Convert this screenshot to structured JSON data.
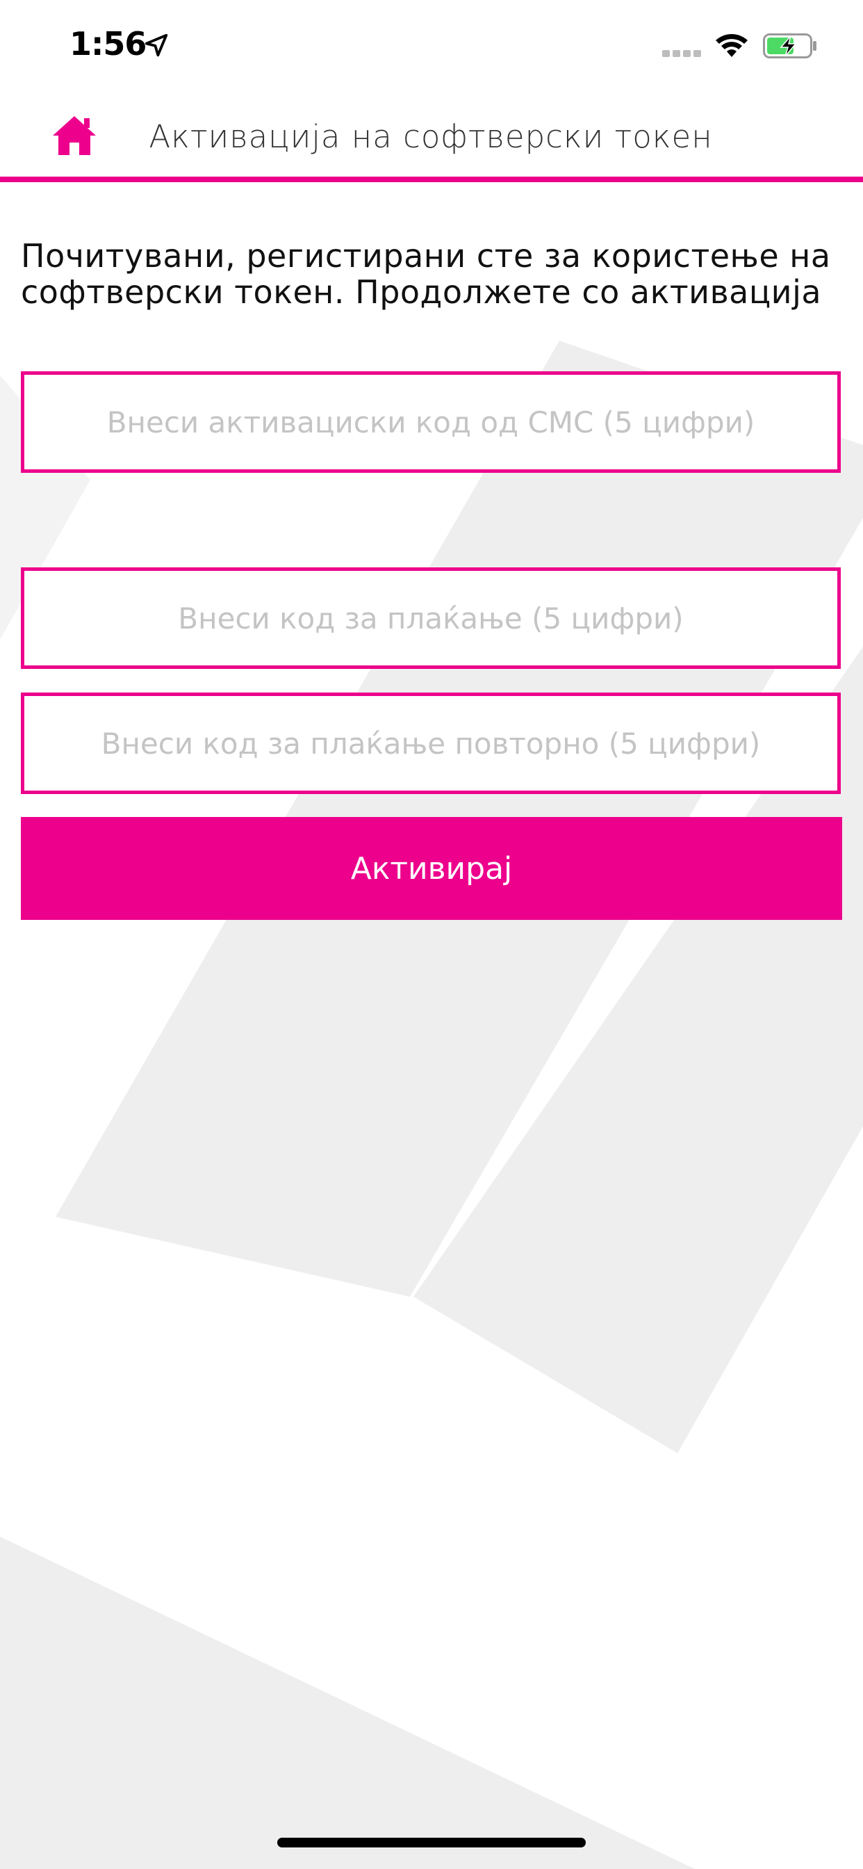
{
  "status_bar": {
    "time": "1:56",
    "icons": [
      "location-arrow-icon",
      "cellular-signal-icon",
      "wifi-icon",
      "battery-charging-icon"
    ]
  },
  "nav": {
    "title": "Активација на софтверски токен",
    "home_icon": "home-icon"
  },
  "main": {
    "intro": "Почитувани, регистирани сте за користење на софтверски токен. Продолжете со активација",
    "sms_code_placeholder": "Внеси активациски код од СМС (5 цифри)",
    "payment_code_placeholder": "Внеси код за плаќање (5 цифри)",
    "payment_code_repeat_placeholder": "Внеси код за плаќање повторно (5 цифри)",
    "activate_label": "Активирај"
  },
  "colors": {
    "accent": "#EC008C",
    "background_pattern": "#EEEEEE",
    "battery_fill": "#4CD964"
  }
}
